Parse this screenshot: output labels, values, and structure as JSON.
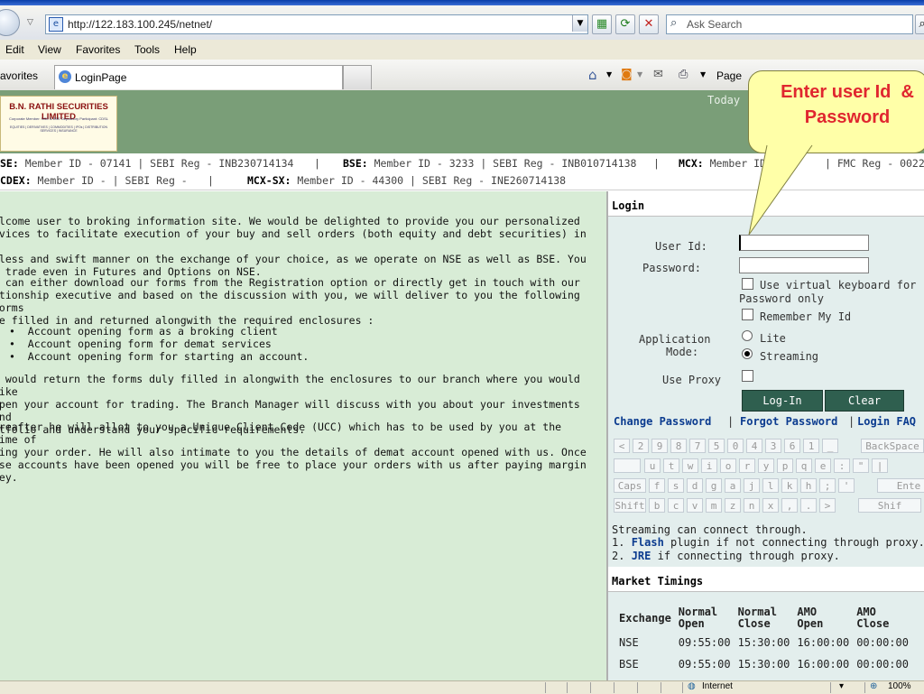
{
  "browser": {
    "address": "http://122.183.100.245/netnet/",
    "search_placeholder": "Ask Search",
    "menu": [
      "Edit",
      "View",
      "Favorites",
      "Tools",
      "Help"
    ],
    "favorites_label": "avorites",
    "tab_title": "LoginPage",
    "page_label": "Page",
    "status_zone": "Internet",
    "zoom": "100%"
  },
  "header": {
    "logo_title": "B.N. RATHI SECURITIES LIMITED",
    "logo_sub1": "Corporate Member: NSE & BSE Depository Participant: CDSL",
    "logo_sub2": "EQUITIES | DERIVATIVES | COMMODITIES | IPOs | DISTRIBUTION SERVICES | INSURANCE",
    "today_label": "Today",
    "member_line1": [
      {
        "exchange": "SE:",
        "text": " Member ID - 07141 | SEBI Reg - INB230714134"
      },
      {
        "exchange": "BSE:",
        "text": " Member ID - 3233 | SEBI Reg - INB010714138"
      },
      {
        "exchange": "MCX:",
        "text": " Member ID"
      },
      {
        "exchange": "",
        "text": "| FMC Reg - 0022"
      }
    ],
    "member_line2": [
      {
        "exchange": "CDEX:",
        "text": " Member ID - | SEBI Reg -"
      },
      {
        "exchange": "MCX-SX:",
        "text": " Member ID - 44300 | SEBI Reg - INE260714138"
      }
    ]
  },
  "content": {
    "para1": "elcome user to broking information site. We would be delighted to provide you our personalized\nrvices to facilitate execution of your buy and sell orders (both equity and debt securities) in a\nwless and swift manner on the exchange of your choice, as we operate on NSE as well as BSE. You\nn trade even in Futures and Options on NSE.",
    "para2": "u can either download our forms from the Registration option or directly get in touch with our\nationship executive and based on the discussion with you, we will deliver to you the following forms\nbe filled in and returned alongwith the required enclosures :",
    "bullets": [
      "Account opening form as a broking client",
      "Account opening form for demat services",
      "Account opening form for starting an account."
    ],
    "para3": "u would return the forms duly filled in alongwith the enclosures to our branch where you would like\nopen your account for trading. The Branch Manager will discuss with you about your investments and\nrtfolio and understand your specific requirements.",
    "para4": "ereafter he will allot to you a Unique Client Code (UCC) which has to be used by you at the time of\ncing your order. He will also intimate to you the details of demat account opened with us. Once\nese accounts have been opened you will be free to place your orders with us after paying margin\nney."
  },
  "login": {
    "heading": "Login",
    "user_id_label": "User Id:",
    "password_label": "Password:",
    "user_id_value": "",
    "password_value": "",
    "virtual_kb_label": "Use virtual keyboard for",
    "virtual_kb_label2": "Password only",
    "remember_label": "Remember My Id",
    "app_mode_label1": "Application",
    "app_mode_label2": "Mode:",
    "mode_lite": "Lite",
    "mode_streaming": "Streaming",
    "proxy_label": "Use Proxy",
    "login_btn": "Log-In",
    "clear_btn": "Clear",
    "change_pw": "Change Password",
    "forgot_pw": "Forgot Password",
    "login_faq": "Login FAQ",
    "sep": "|"
  },
  "vkeyboard": {
    "row1": [
      "<",
      "2",
      "9",
      "8",
      "7",
      "5",
      "0",
      "4",
      "3",
      "6",
      "1",
      "_",
      "BackSpace"
    ],
    "row2": [
      "u",
      "t",
      "w",
      "i",
      "o",
      "r",
      "y",
      "p",
      "q",
      "e",
      ":",
      "\"",
      "|"
    ],
    "row3": [
      "Caps",
      "f",
      "s",
      "d",
      "g",
      "a",
      "j",
      "l",
      "k",
      "h",
      ";",
      "'",
      "Ente"
    ],
    "row4": [
      "Shift",
      "b",
      "c",
      "v",
      "m",
      "z",
      "n",
      "x",
      ",",
      ".",
      ">",
      "Shif"
    ]
  },
  "streaming": {
    "line1": "Streaming can connect through.",
    "flash_prefix": "1.",
    "flash": "Flash",
    "flash_rest": "plugin if not connecting through proxy.",
    "jre_prefix": "2.",
    "jre": "JRE",
    "jre_rest": "if connecting through proxy."
  },
  "market": {
    "heading": "Market Timings",
    "headers": [
      [
        "Exchange"
      ],
      [
        "Normal",
        "Open"
      ],
      [
        "Normal",
        "Close"
      ],
      [
        "AMO",
        "Open"
      ],
      [
        "AMO",
        "Close"
      ]
    ],
    "rows": [
      [
        "NSE",
        "09:55:00",
        "15:30:00",
        "16:00:00",
        "00:00:00"
      ],
      [
        "BSE",
        "09:55:00",
        "15:30:00",
        "16:00:00",
        "00:00:00"
      ]
    ]
  },
  "callout": {
    "line1": "Enter user Id  &",
    "line2": "Password"
  }
}
